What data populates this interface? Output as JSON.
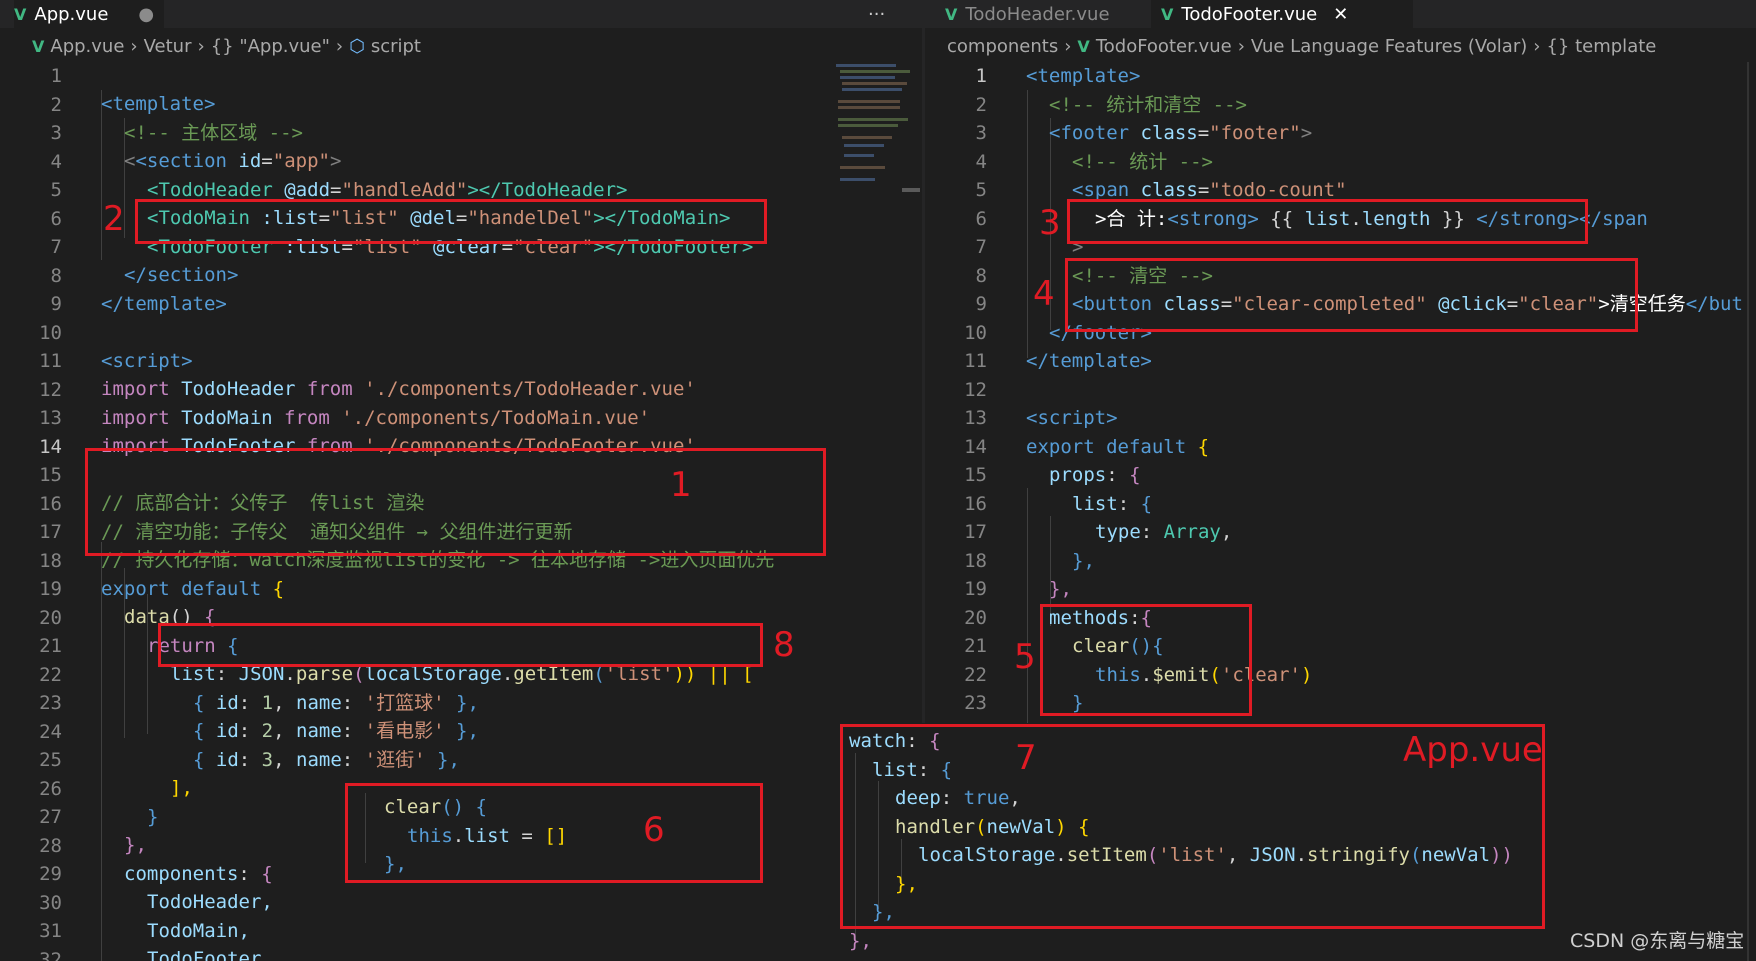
{
  "left_tabs": {
    "tab1": "App.vue",
    "more": "···"
  },
  "right_tabs": {
    "tab1": "TodoHeader.vue",
    "tab2": "TodoFooter.vue",
    "close": "✕"
  },
  "left_breadcrumb": [
    "App.vue",
    "Vetur",
    "{} \"App.vue\"",
    "script"
  ],
  "right_breadcrumb": [
    "components",
    "TodoFooter.vue",
    "Vue Language Features (Volar)",
    "{} template"
  ],
  "left_code": {
    "l1": "<template>",
    "l2": "<!-- 主体区域 -->",
    "l3a": "<section ",
    "l3b": "id",
    "l3c": "=",
    "l3d": "\"app\"",
    "l3e": ">",
    "l4a": "<TodoHeader ",
    "l4b": "@add",
    "l4c": "=",
    "l4d": "\"handleAdd\"",
    "l4e": "></TodoHeader>",
    "l5a": "<TodoMain ",
    "l5b": ":list",
    "l5c": "=",
    "l5d": "\"list\"",
    "l5e": " @del",
    "l5f": "=",
    "l5g": "\"handelDel\"",
    "l5h": "></TodoMain>",
    "l6a": "<TodoFooter ",
    "l6b": ":list",
    "l6c": "=",
    "l6d": "\"list\"",
    "l6e": " @clear",
    "l6f": "=",
    "l6g": "\"clear\"",
    "l6h": "></TodoFooter>",
    "l7": "</section>",
    "l8": "</template>",
    "l10": "<script>",
    "l11a": "import ",
    "l11b": "TodoHeader",
    "l11c": " from ",
    "l11d": "'./components/TodoHeader.vue'",
    "l12a": "import ",
    "l12b": "TodoMain",
    "l12c": " from ",
    "l12d": "'./components/TodoMain.vue'",
    "l13a": "import ",
    "l13b": "TodoFooter",
    "l13c": " from ",
    "l13d": "'./components/TodoFooter.vue'",
    "l15": "// 底部合计：父传子  传list 渲染",
    "l16": "// 清空功能：子传父  通知父组件 → 父组件进行更新",
    "l17": "// 持久化存储：watch深度监视list的变化 -> 往本地存储 ->进入页面优先",
    "l18a": "export ",
    "l18b": "default ",
    "l18c": "{",
    "l19a": "data",
    "l19b": "() ",
    "l19c": "{",
    "l20a": "return ",
    "l20b": "{",
    "l21a": "list",
    "l21b": ": ",
    "l21c": "JSON",
    "l21d": ".",
    "l21e": "parse",
    "l21f": "(",
    "l21g": "localStorage",
    "l21h": ".",
    "l21i": "getItem",
    "l21j": "(",
    "l21k": "'list'",
    "l21l": ")) || [",
    "l22a": "{ ",
    "l22b": "id",
    "l22c": ": ",
    "l22d": "1",
    "l22e": ", ",
    "l22f": "name",
    "l22g": ": ",
    "l22h": "'打篮球'",
    "l22i": " },",
    "l23a": "{ ",
    "l23b": "id",
    "l23c": ": ",
    "l23d": "2",
    "l23e": ", ",
    "l23f": "name",
    "l23g": ": ",
    "l23h": "'看电影'",
    "l23i": " },",
    "l24a": "{ ",
    "l24b": "id",
    "l24c": ": ",
    "l24d": "3",
    "l24e": ", ",
    "l24f": "name",
    "l24g": ": ",
    "l24h": "'逛街'",
    "l24i": " },",
    "l25": "],",
    "l26": "}",
    "l27": "},",
    "l28a": "components",
    "l28b": ": ",
    "l28c": "{",
    "l29": "TodoHeader,",
    "l30": "TodoMain,",
    "l31": "TodoFooter,",
    "l32": "}",
    "l26b_a": "clear",
    "l26b_b": "() ",
    "l26b_c": "{",
    "l27b_a": "this",
    "l27b_b": ".",
    "l27b_c": "list",
    "l27b_d": " = ",
    "l27b_e": "[]",
    "l28b_a": "},"
  },
  "right_code": {
    "r1": "<template>",
    "r2": "<!-- 统计和清空 -->",
    "r3a": "<footer ",
    "r3b": "class",
    "r3c": "=",
    "r3d": "\"footer\"",
    "r3e": ">",
    "r4": "<!-- 统计 -->",
    "r5a": "<span ",
    "r5b": "class",
    "r5c": "=",
    "r5d": "\"todo-count\"",
    "r6a": ">合 计:",
    "r6b": "<strong>",
    "r6c": " {{ ",
    "r6d": "list",
    "r6e": ".",
    "r6f": "length",
    "r6g": " }} ",
    "r6h": "</strong></span",
    "r7": ">",
    "r8": "<!-- 清空 -->",
    "r9a": "<button ",
    "r9b": "class",
    "r9c": "=",
    "r9d": "\"clear-completed\"",
    "r9e": " @click",
    "r9f": "=",
    "r9g": "\"clear\"",
    "r9h": ">清空任务",
    "r9i": "</but",
    "r10": "</footer>",
    "r11": "</template>",
    "r13": "<script>",
    "r14a": "export ",
    "r14b": "default ",
    "r14c": "{",
    "r15a": "props",
    "r15b": ": ",
    "r15c": "{",
    "r16a": "list",
    "r16b": ": ",
    "r16c": "{",
    "r17a": "type",
    "r17b": ": ",
    "r17c": "Array",
    "r17d": ",",
    "r18": "},",
    "r19": "},",
    "r20a": "methods",
    "r20b": ":",
    "r20c": "{",
    "r21a": "clear",
    "r21b": "()",
    "r21c": "{",
    "r22a": "this",
    "r22b": ".",
    "r22c": "$emit",
    "r22d": "(",
    "r22e": "'clear'",
    "r22f": ")",
    "r23": "}"
  },
  "watch_overlay": {
    "w1a": "watch",
    "w1b": ": ",
    "w1c": "{",
    "w2a": "list",
    "w2b": ": ",
    "w2c": "{",
    "w3a": "deep",
    "w3b": ": ",
    "w3c": "true",
    "w3d": ",",
    "w4a": "handler",
    "w4b": "(",
    "w4c": "newVal",
    "w4d": ") ",
    "w4e": "{",
    "w5a": "localStorage",
    "w5b": ".",
    "w5c": "setItem",
    "w5d": "(",
    "w5e": "'list'",
    "w5f": ", ",
    "w5g": "JSON",
    "w5h": ".",
    "w5i": "stringify",
    "w5j": "(",
    "w5k": "newVal",
    "w5l": "))",
    "w6": "},",
    "w7": "},",
    "w8": "},",
    "label": "App.vue"
  },
  "annotations": [
    "1",
    "2",
    "3",
    "4",
    "5",
    "6",
    "7",
    "8"
  ],
  "watermark": "CSDN @东离与糖宝"
}
